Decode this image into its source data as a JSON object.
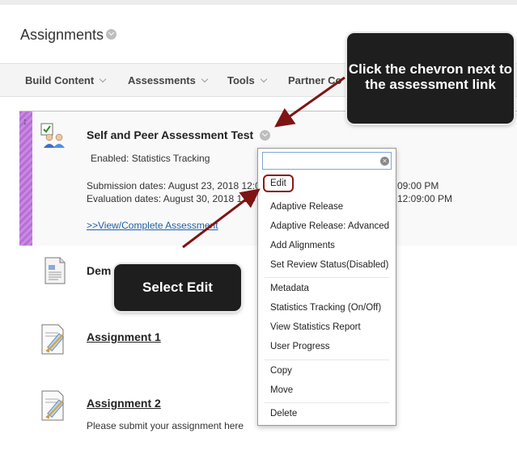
{
  "page": {
    "title": "Assignments"
  },
  "toolbar": {
    "items": [
      {
        "label": "Build Content"
      },
      {
        "label": "Assessments"
      },
      {
        "label": "Tools"
      },
      {
        "label": "Partner Co"
      }
    ]
  },
  "content": {
    "items": [
      {
        "title": "Self and Peer Assessment Test",
        "enabled": "Enabled:  Statistics Tracking",
        "submission_dates": "Submission dates: August 23, 2018 12:0",
        "submission_end": "09:00 PM",
        "evaluation_dates": "Evaluation dates: August 30, 2018 12:0",
        "evaluation_end": "12:09:00 PM",
        "link": ">>View/Complete Assessment"
      },
      {
        "title": "Dem"
      },
      {
        "title": "Assignment 1"
      },
      {
        "title": "Assignment 2",
        "description": "Please submit your assignment here"
      }
    ]
  },
  "context_menu": {
    "search_value": "",
    "items": [
      "Edit",
      "Adaptive Release",
      "Adaptive Release: Advanced",
      "Add Alignments",
      "Set Review Status(Disabled)",
      "Metadata",
      "Statistics Tracking (On/Off)",
      "View Statistics Report",
      "User Progress",
      "Copy",
      "Move",
      "Delete"
    ]
  },
  "callouts": {
    "chevron_tip": "Click the chevron next to the assessment link",
    "edit_tip": "Select Edit"
  },
  "colors": {
    "accent_strip": "#b76fd6",
    "callout_bg": "#1e1e1e",
    "highlight": "#8b1a1a"
  }
}
